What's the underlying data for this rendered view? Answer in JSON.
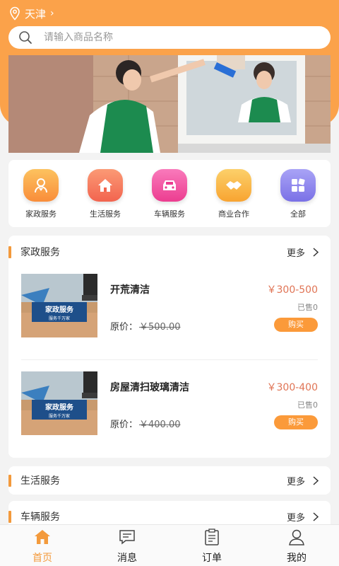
{
  "location": {
    "city": "天津"
  },
  "search": {
    "placeholder": "请输入商品名称"
  },
  "categories": [
    {
      "label": "家政服务",
      "icon": "housekeeper-icon",
      "color": "#fba84a"
    },
    {
      "label": "生活服务",
      "icon": "home-icon",
      "color": "#f77a5e"
    },
    {
      "label": "车辆服务",
      "icon": "car-icon",
      "color": "#f55aa3"
    },
    {
      "label": "商业合作",
      "icon": "handshake-icon",
      "color": "#fbb040"
    },
    {
      "label": "全部",
      "icon": "grid-icon",
      "color": "#8d86ee"
    }
  ],
  "sections": [
    {
      "title": "家政服务",
      "more": "更多",
      "items": [
        {
          "name": "开荒清洁",
          "price": "￥300-500",
          "sold": "已售0",
          "orig_label": "原价：",
          "orig_price": "￥500.00",
          "buy": "购买",
          "thumb_title": "家政服务",
          "thumb_sub": "服务千万家"
        },
        {
          "name": "房屋清扫玻璃清洁",
          "price": "￥300-400",
          "sold": "已售0",
          "orig_label": "原价：",
          "orig_price": "￥400.00",
          "buy": "购买",
          "thumb_title": "家政服务",
          "thumb_sub": "服务千万家"
        }
      ]
    },
    {
      "title": "生活服务",
      "more": "更多"
    },
    {
      "title": "车辆服务",
      "more": "更多"
    }
  ],
  "tabs": [
    {
      "label": "首页",
      "icon": "home-tab-icon",
      "active": true
    },
    {
      "label": "消息",
      "icon": "message-icon",
      "active": false
    },
    {
      "label": "订单",
      "icon": "clipboard-icon",
      "active": false
    },
    {
      "label": "我的",
      "icon": "user-icon",
      "active": false
    }
  ],
  "colors": {
    "accent": "#fba24a",
    "price": "#e07455"
  }
}
